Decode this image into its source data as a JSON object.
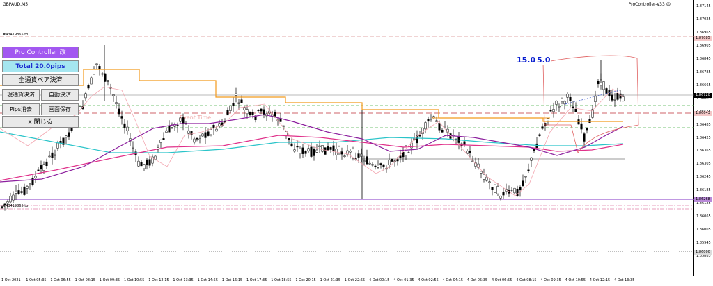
{
  "chart": {
    "symbol": "GBPAUD,M5",
    "ea_name": "ProController-V33",
    "ea_icon": "smiley-icon",
    "account_line_label": "#43419865 to",
    "account_line_label2": "#43419865 to",
    "event_label": "Event Time"
  },
  "panel": {
    "title": "Pro Controller 改",
    "total": "Total   20.0pips",
    "close_all": "全通貨ペア決済",
    "current_pair": "現通貨決済",
    "auto_close": "自動決済",
    "pips_delete": "Pips消去",
    "screen_save": "画面保存",
    "close": "x 閉じる"
  },
  "markers": {
    "a": "15.0",
    "b": "5.0"
  },
  "price_axis": {
    "labels": [
      "1.87145",
      "1.87025",
      "1.86965",
      "1.86905",
      "1.86845",
      "1.86785",
      "1.86665",
      "1.86605",
      "1.86545",
      "1.86485",
      "1.86425",
      "1.86365",
      "1.86305",
      "1.86245",
      "1.86185",
      "1.86125",
      "1.86065",
      "1.86005",
      "1.85945",
      "1.85885"
    ],
    "boxes": [
      {
        "text": "1.87085",
        "color": "#f4c8c8"
      },
      {
        "text": "1.86720",
        "color": "#000000",
        "fg": "#ffffff"
      },
      {
        "text": "1.86643",
        "color": "#f4c8c8"
      },
      {
        "text": "1.86268",
        "color": "#b98ad8"
      },
      {
        "text": "1.86000",
        "color": "#dddddd"
      }
    ]
  },
  "time_axis": {
    "labels": [
      "1 Oct 2021",
      "1 Oct 05:35",
      "1 Oct 06:55",
      "1 Oct 08:15",
      "1 Oct 09:35",
      "1 Oct 10:55",
      "1 Oct 12:15",
      "1 Oct 13:35",
      "1 Oct 14:55",
      "1 Oct 16:15",
      "1 Oct 17:35",
      "1 Oct 18:55",
      "1 Oct 20:15",
      "1 Oct 21:35",
      "1 Oct 22:55",
      "4 Oct 00:15",
      "4 Oct 01:35",
      "4 Oct 02:55",
      "4 Oct 04:15",
      "4 Oct 05:35",
      "4 Oct 06:55",
      "4 Oct 08:15",
      "4 Oct 09:35",
      "4 Oct 10:55",
      "4 Oct 12:15",
      "4 Oct 13:35"
    ]
  },
  "colors": {
    "bull": "#000000",
    "bear": "#000000",
    "ma_orange": "#f29a1c",
    "ma_purple": "#8c1f9e",
    "ma_magenta": "#e0308a",
    "ma_cyan": "#2ac4c9",
    "ma_pink": "#f3a6b0",
    "level_pink": "#d98a8a",
    "level_purple": "#9a5ad0",
    "level_green": "#49b049",
    "level_gray": "#777777"
  }
}
